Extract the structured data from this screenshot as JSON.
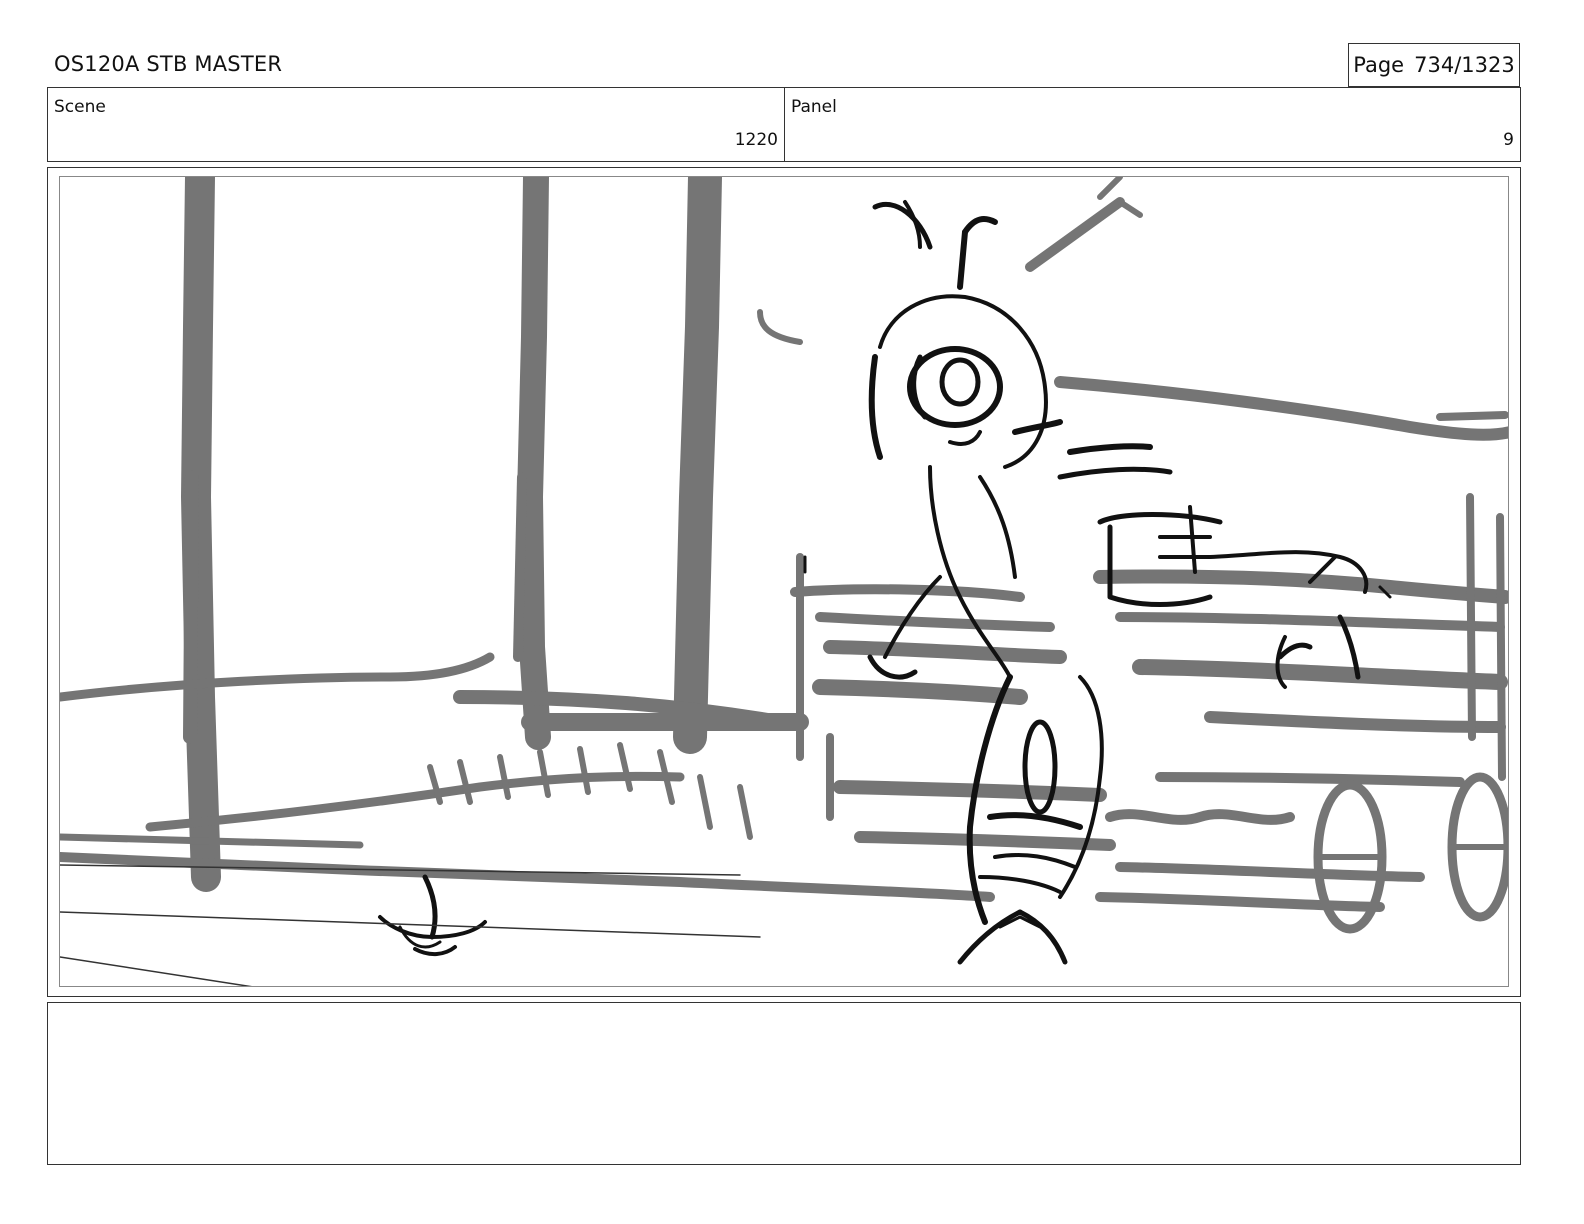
{
  "header": {
    "doc_title": "OS120A STB MASTER",
    "page_label": "Page",
    "page_value": "734/1323"
  },
  "scene": {
    "label": "Scene",
    "value": "1220"
  },
  "panel": {
    "label": "Panel",
    "value": "9"
  },
  "sketch": {
    "ink_color": "#111111",
    "tone_color": "#6e6e6e"
  },
  "notes": {
    "text": ""
  }
}
